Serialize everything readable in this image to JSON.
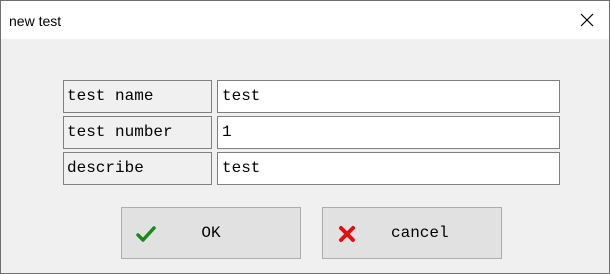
{
  "window": {
    "title": "new test"
  },
  "form": {
    "rows": [
      {
        "label": "test name",
        "value": "test"
      },
      {
        "label": "test number",
        "value": "1"
      },
      {
        "label": "describe",
        "value": "test"
      }
    ]
  },
  "buttons": {
    "ok_label": "OK",
    "cancel_label": "cancel"
  },
  "icons": {
    "close": "close-icon",
    "ok": "checkmark-icon",
    "cancel": "x-icon"
  },
  "colors": {
    "ok_icon": "#1a8a1a",
    "cancel_icon": "#e01010"
  }
}
